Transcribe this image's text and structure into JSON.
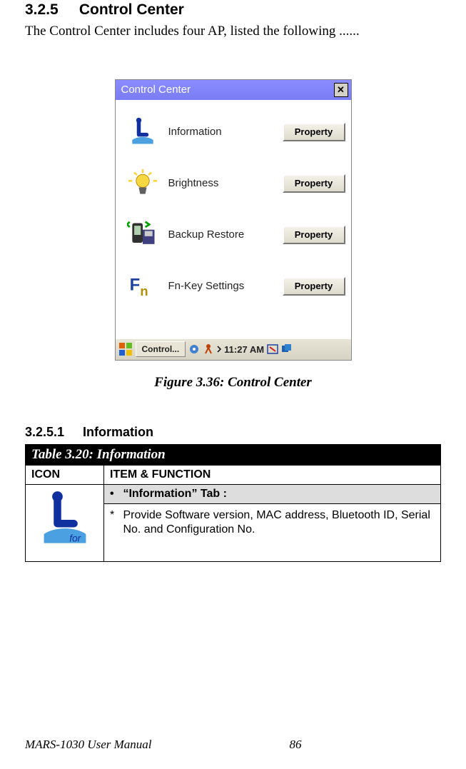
{
  "section": {
    "number": "3.2.5",
    "title": "Control Center"
  },
  "intro": "The Control Center includes four AP, listed the following ......",
  "window": {
    "title": "Control Center",
    "close": "✕",
    "items": [
      {
        "label": "Information",
        "button": "Property"
      },
      {
        "label": "Brightness",
        "button": "Property"
      },
      {
        "label": "Backup Restore",
        "button": "Property"
      },
      {
        "label": "Fn-Key Settings",
        "button": "Property"
      }
    ],
    "taskbar": {
      "task_label": "Control...",
      "clock": "11:27 AM"
    }
  },
  "figure_caption": "Figure 3.36: Control Center",
  "subsection": {
    "number": "3.2.5.1",
    "title": "Information"
  },
  "table": {
    "title": "Table 3.20: Information",
    "col1": "ICON",
    "col2": "ITEM & FUNCTION",
    "tab_label": "“Information” Tab :",
    "desc": "Provide Software version, MAC address, Bluetooth ID, Serial No. and Configuration No."
  },
  "footer": {
    "manual": "MARS-1030 User Manual",
    "page": "86"
  }
}
